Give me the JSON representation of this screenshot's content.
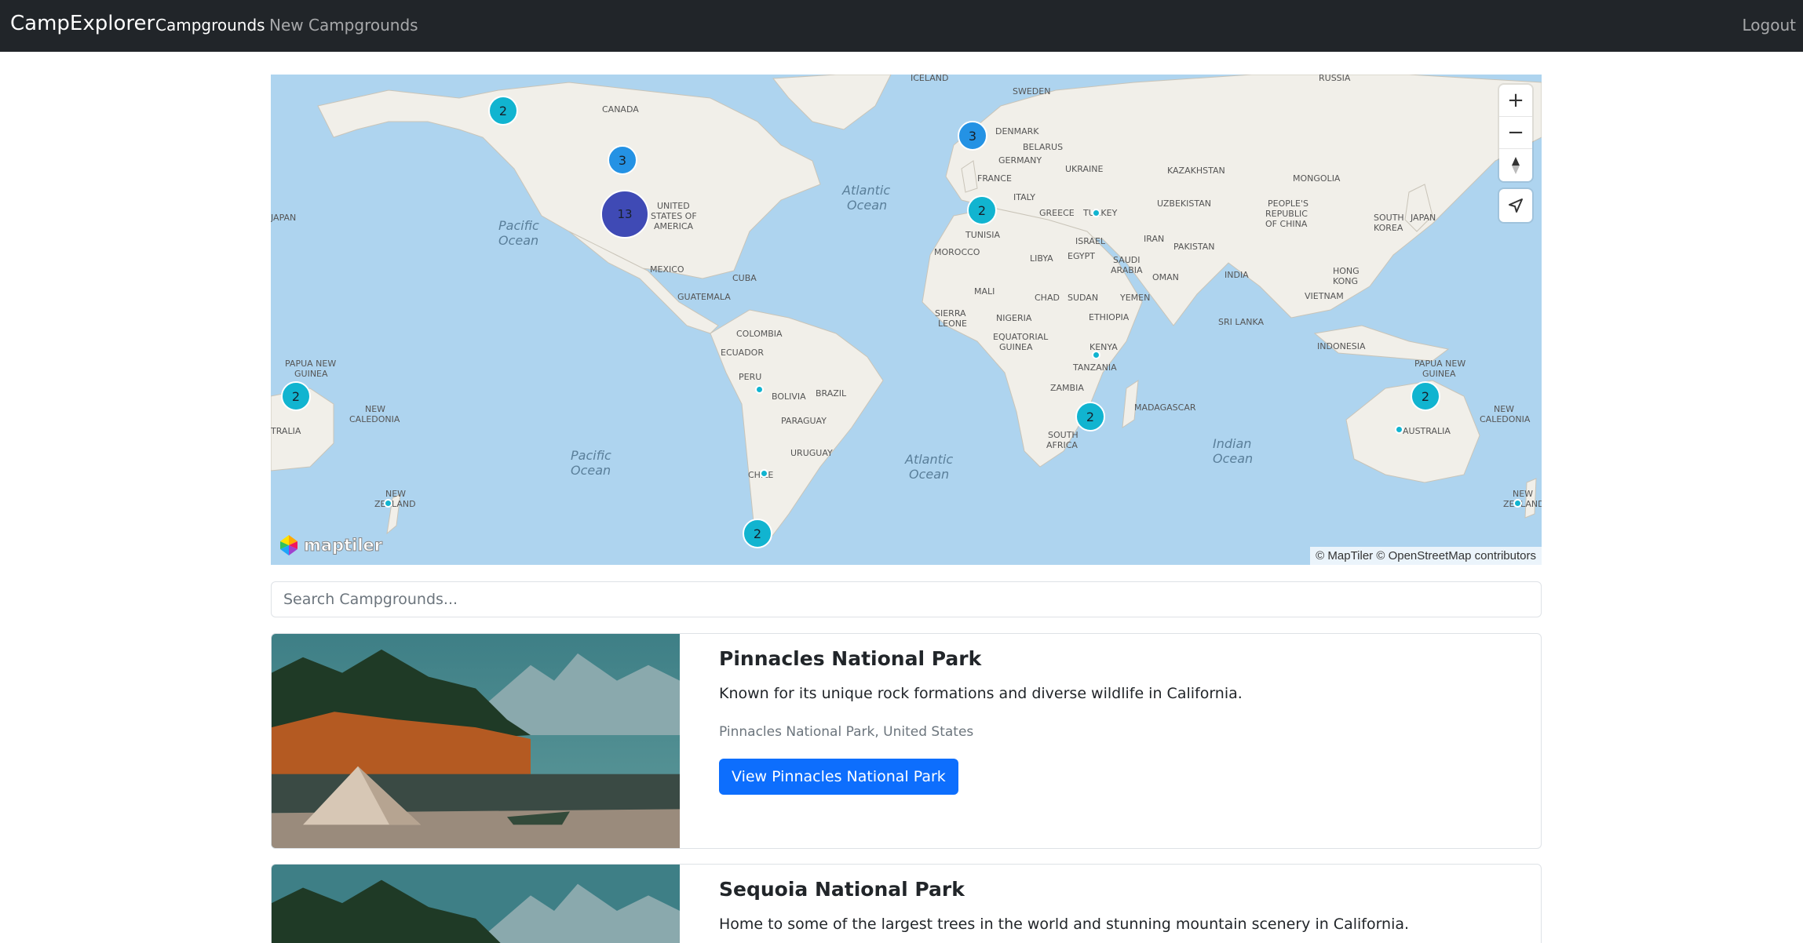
{
  "navbar": {
    "brand": "CampExplorer",
    "links": [
      "Campgrounds",
      "New Campgrounds"
    ],
    "logout": "Logout"
  },
  "map": {
    "labels": {
      "countries": [
        "ICELAND",
        "SWEDEN",
        "RUSSIA",
        "CANADA",
        "DENMARK",
        "BELARUS",
        "GERMANY",
        "UKRAINE",
        "KAZAKHSTAN",
        "FRANCE",
        "ITALY",
        "MONGOLIA",
        "UZBEKISTAN",
        "GREECE",
        "TURKEY",
        "PEOPLE'S",
        "REPUBLIC",
        "OF CHINA",
        "JAPAN",
        "SOUTH",
        "KOREA",
        "UNITED",
        "STATES OF",
        "AMERICA",
        "TUNISIA",
        "IRAN",
        "MOROCCO",
        "ISRAEL",
        "PAKISTAN",
        "LIBYA",
        "EGYPT",
        "SAUDI",
        "ARABIA",
        "OMAN",
        "INDIA",
        "HONG",
        "KONG",
        "MEXICO",
        "CUBA",
        "GUATEMALA",
        "MALI",
        "CHAD",
        "SUDAN",
        "YEMEN",
        "VIETNAM",
        "ETHIOPIA",
        "SIERRA",
        "LEONE",
        "NIGERIA",
        "SRI LANKA",
        "COLOMBIA",
        "EQUATORIAL",
        "GUINEA",
        "ECUADOR",
        "KENYA",
        "INDONESIA",
        "PAPUA NEW",
        "GUINEA",
        "PERU",
        "TANZANIA",
        "BRAZIL",
        "BOLIVIA",
        "ZAMBIA",
        "MADAGASCAR",
        "PARAGUAY",
        "NEW",
        "CALEDONIA",
        "AUSTRALIA",
        "SOUTH",
        "AFRICA",
        "URUGUAY",
        "CHILE",
        "NEW",
        "ZEALAND",
        "TRALIA"
      ],
      "oceans": [
        "Atlantic",
        "Ocean",
        "Pacific",
        "Ocean",
        "Pacific",
        "Ocean",
        "Atlantic",
        "Ocean",
        "Indian",
        "Ocean"
      ]
    },
    "clusters": [
      "2",
      "3",
      "13",
      "3",
      "2",
      "2",
      "2",
      "2",
      "2"
    ],
    "controls": {
      "zoom_in": "+",
      "zoom_out": "−"
    },
    "logo_text": "maptiler",
    "attribution": "© MapTiler © OpenStreetMap contributors",
    "colors": {
      "water": "#aed4ef",
      "land": "#f1efe9",
      "cluster_small": "#11b4d0",
      "cluster_medium": "#2492e4",
      "cluster_large": "#3f4ab5"
    }
  },
  "search": {
    "placeholder": "Search Campgrounds..."
  },
  "campgrounds": [
    {
      "title": "Pinnacles National Park",
      "description": "Known for its unique rock formations and diverse wildlife in California.",
      "location": "Pinnacles National Park, United States",
      "button": "View Pinnacles National Park"
    },
    {
      "title": "Sequoia National Park",
      "description": "Home to some of the largest trees in the world and stunning mountain scenery in California."
    }
  ],
  "colors": {
    "navbar": "#212529",
    "primary_button": "#0d6efd"
  }
}
